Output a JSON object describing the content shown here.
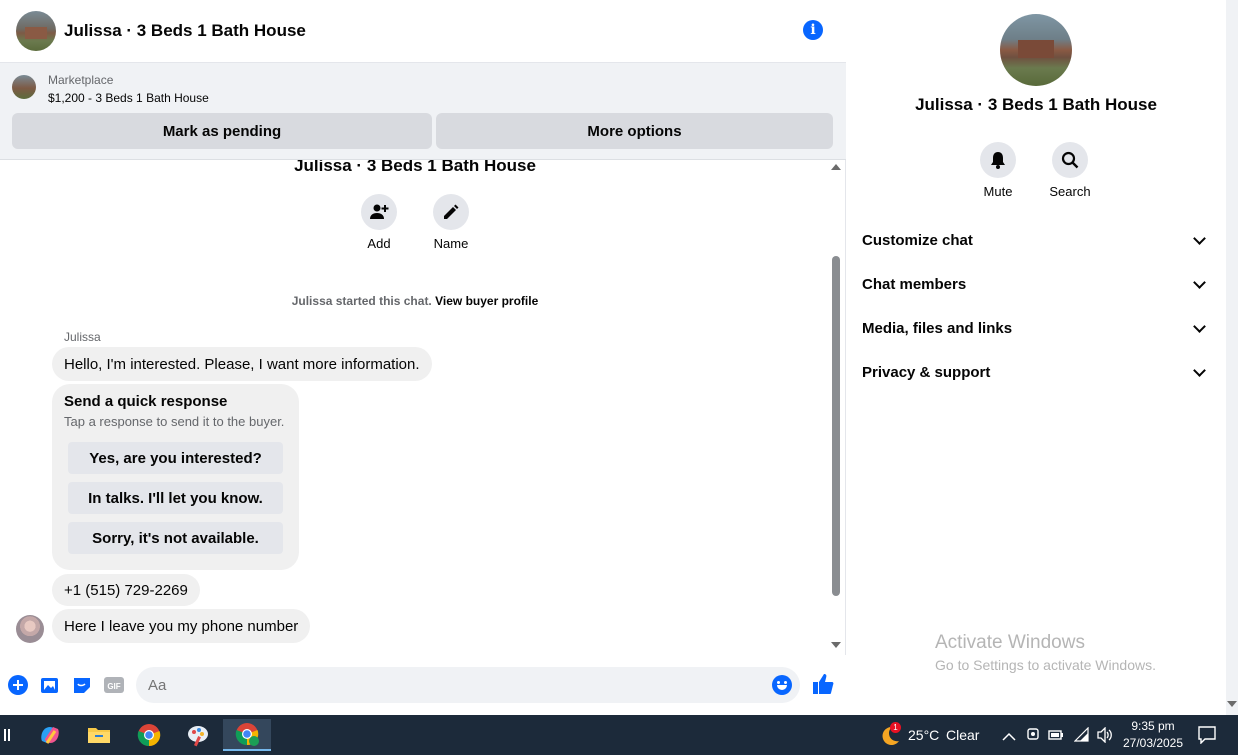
{
  "header": {
    "title": "Julissa · 3 Beds 1 Bath House",
    "info_icon": "info-icon"
  },
  "marketplace": {
    "label": "Marketplace",
    "listing": "$1,200 - 3 Beds 1 Bath House",
    "mark_pending_label": "Mark as pending",
    "more_options_label": "More options"
  },
  "conversation": {
    "title": "Julissa · 3 Beds 1 Bath House",
    "actions": [
      {
        "label": "Add",
        "icon": "add-person-icon"
      },
      {
        "label": "Name",
        "icon": "pencil-icon"
      }
    ],
    "started_text": "Julissa started this chat.",
    "view_profile_link": "View buyer profile",
    "sender_name": "Julissa",
    "messages": {
      "first": "Hello, I'm interested. Please, I want more information.",
      "phone": "+1 (515) 729-2269",
      "last": "Here I leave you my phone number"
    },
    "quick_response": {
      "title": "Send a quick response",
      "subtitle": "Tap a response to send it to the buyer.",
      "options": [
        "Yes, are you interested?",
        "In talks. I'll let you know.",
        "Sorry, it's not available."
      ]
    }
  },
  "composer": {
    "placeholder": "Aa"
  },
  "panel": {
    "title": "Julissa · 3 Beds 1 Bath House",
    "actions": [
      {
        "label": "Mute",
        "icon": "bell-icon"
      },
      {
        "label": "Search",
        "icon": "search-icon"
      }
    ],
    "sections": [
      "Customize chat",
      "Chat members",
      "Media, files and links",
      "Privacy & support"
    ],
    "watermark_title": "Activate Windows",
    "watermark_sub": "Go to Settings to activate Windows."
  },
  "taskbar": {
    "weather_badge": "1",
    "temperature": "25°C",
    "condition": "Clear",
    "time": "9:35 pm",
    "date": "27/03/2025"
  },
  "colors": {
    "accent": "#0866ff",
    "bubble": "#f0f0f0",
    "taskbar": "#1c2a3a"
  }
}
